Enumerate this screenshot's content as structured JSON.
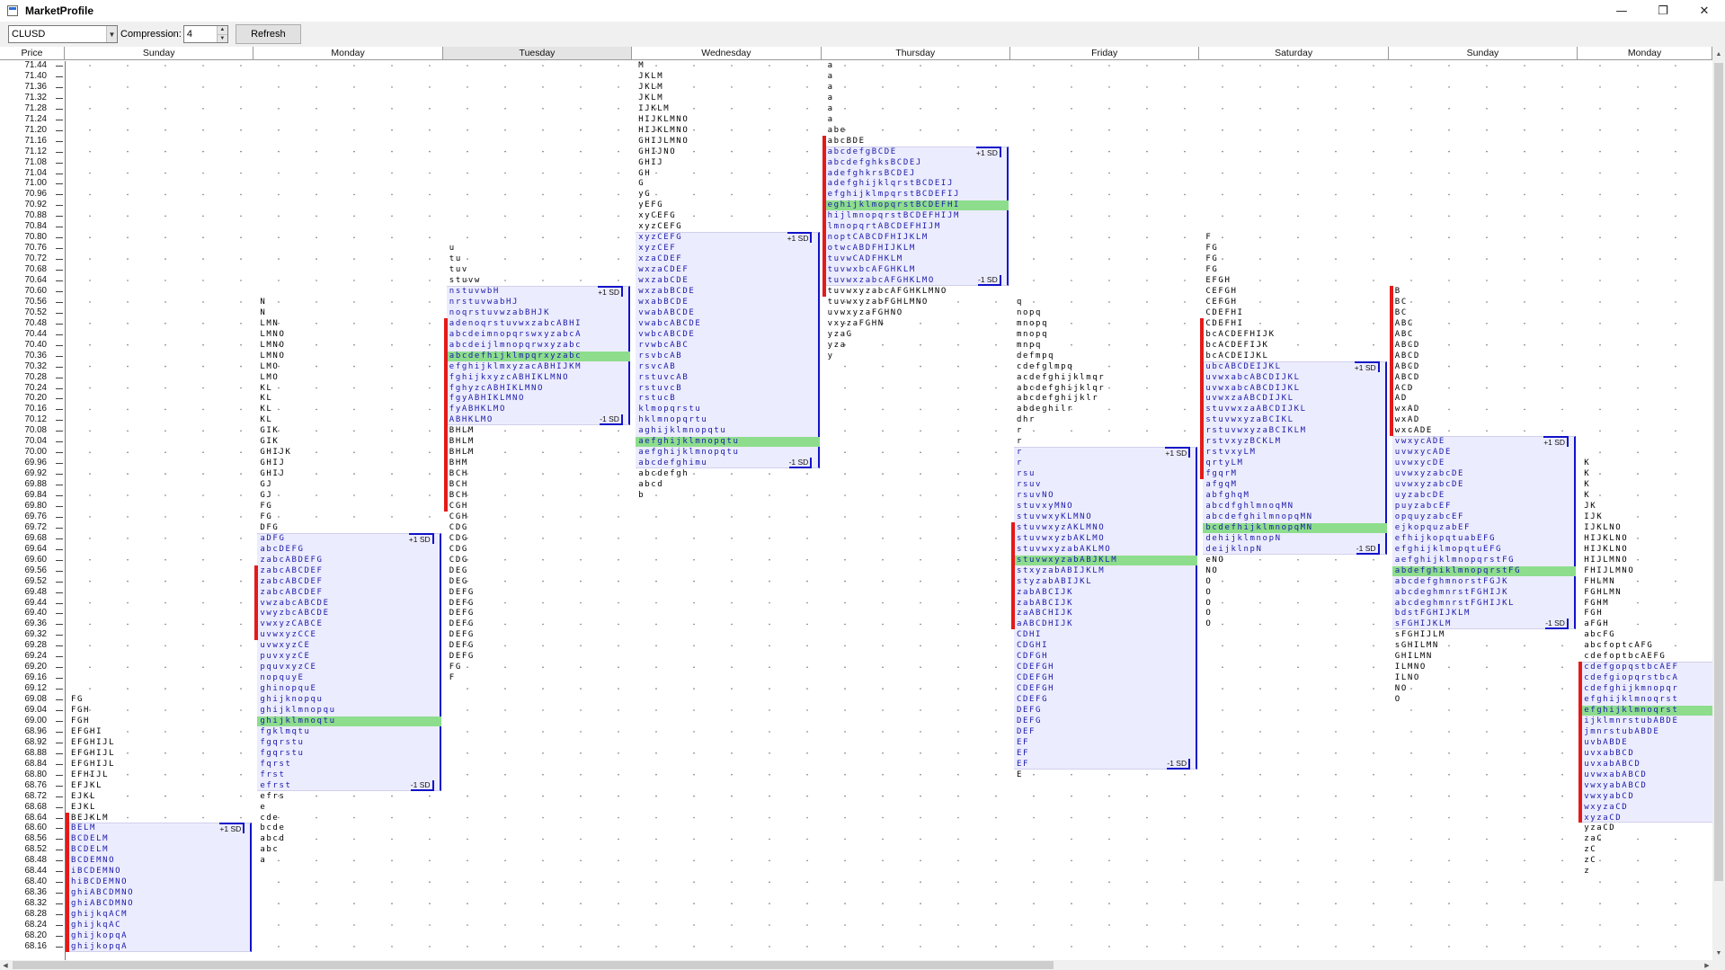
{
  "window": {
    "title": "MarketProfile",
    "controls": {
      "minimize": "—",
      "maximize": "❐",
      "close": "✕"
    }
  },
  "toolbar": {
    "symbol": "CLUSD",
    "compression_label": "Compression:",
    "compression_value": "4",
    "refresh_label": "Refresh"
  },
  "grid": {
    "price_header": "Price",
    "days": [
      {
        "label": "Sunday",
        "selected": false
      },
      {
        "label": "Monday",
        "selected": false
      },
      {
        "label": "Tuesday",
        "selected": true
      },
      {
        "label": "Wednesday",
        "selected": false
      },
      {
        "label": "Thursday",
        "selected": false
      },
      {
        "label": "Friday",
        "selected": false
      },
      {
        "label": "Saturday",
        "selected": false
      },
      {
        "label": "Sunday",
        "selected": false
      },
      {
        "label": "Monday",
        "selected": false
      }
    ],
    "prices": [
      "71.44",
      "71.40",
      "71.36",
      "71.32",
      "71.28",
      "71.24",
      "71.20",
      "71.16",
      "71.12",
      "71.08",
      "71.04",
      "71.00",
      "70.96",
      "70.92",
      "70.88",
      "70.84",
      "70.80",
      "70.76",
      "70.72",
      "70.68",
      "70.64",
      "70.60",
      "70.56",
      "70.52",
      "70.48",
      "70.44",
      "70.40",
      "70.36",
      "70.32",
      "70.28",
      "70.24",
      "70.20",
      "70.16",
      "70.12",
      "70.08",
      "70.04",
      "70.00",
      "69.96",
      "69.92",
      "69.88",
      "69.84",
      "69.80",
      "69.76",
      "69.72",
      "69.68",
      "69.64",
      "69.60",
      "69.56",
      "69.52",
      "69.48",
      "69.44",
      "69.40",
      "69.36",
      "69.32",
      "69.28",
      "69.24",
      "69.20",
      "69.16",
      "69.12",
      "69.08",
      "69.04",
      "69.00",
      "68.96",
      "68.92",
      "68.88",
      "68.84",
      "68.80",
      "68.76",
      "68.72",
      "68.68",
      "68.64",
      "68.60",
      "68.56",
      "68.52",
      "68.48",
      "68.44",
      "68.40",
      "68.36",
      "68.32",
      "68.28",
      "68.24",
      "68.20",
      "68.16"
    ],
    "sd_upper_label": "+1 SD",
    "sd_lower_label": "-1 SD",
    "colors": {
      "value_area": "#ececff",
      "sd_line": "#1212c8",
      "initial_balance": "#e41a1a",
      "poc": "#8ddd8d",
      "va_letters": "#1a1aa8"
    }
  },
  "profiles": [
    {
      "day": "Sunday",
      "start_price": "69.08",
      "value_area": {
        "high": "68.60",
        "low": "68.16"
      },
      "ib": {
        "high": "68.64",
        "low": "68.16"
      },
      "poc": null,
      "rows": [
        "FG",
        "FGH",
        "FGH",
        "EFGHI",
        "EFGHIJL",
        "EFGHIJL",
        "EFGHIJL",
        "EFHIJL",
        "EFJKL",
        "EJKL",
        "EJKL",
        "BEJKLM",
        "BELM",
        "BCDELM",
        "BCDELM",
        "BCDEMNO",
        "iBCDEMNO",
        "hiBCDEMNO",
        "ghiABCDMNO",
        "ghiABCDMNO",
        "ghijkqACM",
        "ghijkqAC",
        "ghijkopqA",
        "ghijkopqA",
        "ghijkopqA"
      ]
    },
    {
      "day": "Monday",
      "start_price": "70.56",
      "value_area": {
        "high": "69.68",
        "low": "68.76"
      },
      "ib": {
        "high": "69.56",
        "low": "69.32"
      },
      "poc": "69.00",
      "rows": [
        "N",
        "N",
        "LMN",
        "LMNO",
        "LMNO",
        "LMNO",
        "LMO",
        "LMO",
        "KL",
        "KL",
        "KL",
        "KL",
        "GIK",
        "GIK",
        "GHIJK",
        "GHIJ",
        "GHIJ",
        "GJ",
        "GJ",
        "FG",
        "FG",
        "DFG",
        "aDFG",
        "abcDEFG",
        "zabcABDEFG",
        "zabcABCDEF",
        "zabcABCDEF",
        "zabcABCDEF",
        "vwzabcABCDE",
        "vwyzbcABCDE",
        "vwxyzCABCE",
        "uvwxyzCCE",
        "uvwxyzCE",
        "puvxyzCE",
        "pquvxyzCE",
        "nopquyE",
        "ghinopquE",
        "ghijknopqu",
        "ghijklmnopqu",
        "ghijklmnoqtu",
        "fgklmqtu",
        "fgqrstu",
        "fgqrstu",
        "fqrst",
        "frst",
        "efrst",
        "efrs",
        "e",
        "cde",
        "bcde",
        "abcd",
        "abc",
        "a"
      ]
    },
    {
      "day": "Tuesday",
      "start_price": "70.76",
      "value_area": {
        "high": "70.60",
        "low": "70.12"
      },
      "ib": {
        "high": "70.48",
        "low": "69.80"
      },
      "poc": "70.36",
      "rows": [
        "u",
        "tu",
        "tuv",
        "stuvw",
        "nstuvwbH",
        "nrstuvwabHJ",
        "noqrstuvwzabBHJK",
        "adenoqrstuvwxzabcABHI",
        "abcdeimnopqrswxyzabcA",
        "abcdeijlmnopqrwxyzabc",
        "abcdefhijklmpqrxyzabc",
        "efghijklmxyzacABHIJKM",
        "fghijkxyzcABHIKLMNO",
        "fghyzcABHIKLMNO",
        "fgyABHIKLMNO",
        "fyABHKLMO",
        "ABHKLMO",
        "BHLM",
        "BHLM",
        "BHLM",
        "BHM",
        "BCH",
        "BCH",
        "BCH",
        "CGH",
        "CGH",
        "CDG",
        "CDG",
        "CDG",
        "CDG",
        "DEG",
        "DEG",
        "DEFG",
        "DEFG",
        "DEFG",
        "DEFG",
        "DEFG",
        "DEFG",
        "DEFG",
        "FG",
        "F"
      ]
    },
    {
      "day": "Wednesday",
      "start_price": "71.44",
      "value_area": {
        "high": "70.80",
        "low": "69.96"
      },
      "ib": null,
      "poc": "70.04",
      "rows": [
        "M",
        "JKLM",
        "JKLM",
        "JKLM",
        "IJKLM",
        "HIJKLMNO",
        "HIJKLMNO",
        "GHIJLMNO",
        "GHIJNO",
        "GHIJ",
        "GH",
        "G",
        "yG",
        "yEFG",
        "xyCEFG",
        "xyzCEFG",
        "xyzCEFG",
        "xyzCEF",
        "xzaCDEF",
        "wxzaCDEF",
        "wxzabCDE",
        "wxzabBCDE",
        "wxabBCDE",
        "vwabABCDE",
        "vwabcABCDE",
        "vwbcABCDE",
        "rvwbcABC",
        "rsvbcAB",
        "rsvcAB",
        "rstuvcAB",
        "rstuvcB",
        "rstucB",
        "klmopqrstu",
        "hklmnopqrtu",
        "aghijklmnopqtu",
        "aefghijklmnopqtu",
        "aefghijklmnopqtu",
        "abcdefghimu",
        "abcdefgh",
        "abcd",
        "b"
      ]
    },
    {
      "day": "Thursday",
      "start_price": "71.44",
      "value_area": {
        "high": "71.12",
        "low": "70.64"
      },
      "ib": {
        "high": "71.16",
        "low": "70.60"
      },
      "poc": "70.92",
      "rows": [
        "a",
        "a",
        "a",
        "a",
        "a",
        "a",
        "abe",
        "abcBDE",
        "abcdefgBCDE",
        "abcdefghksBCDEJ",
        "adefghkrsBCDEJ",
        "adefghijklqrstBCDEIJ",
        "efghijklmpqrstBCDEFIJ",
        "eghijklmopqrstBCDEFHI",
        "hijlmnopqrstBCDEFHIJM",
        "lmnopqrtABCDEFHIJM",
        "noptCABCDFHIJKLM",
        "otwcABDFHIJKLM",
        "tuvwCADFHKLM",
        "tuvwxbcAFGHKLM",
        "tuvwxzabcAFGHKLMO",
        "tuvwxyzabcAFGHKLMNO",
        "tuvwxyzabFGHLMNO",
        "uvwxyzaFGHNO",
        "vxyzaFGHN",
        "yzaG",
        "yza",
        "y"
      ]
    },
    {
      "day": "Friday",
      "start_price": "70.56",
      "value_area": {
        "high": "70.00",
        "low": "68.84"
      },
      "ib": {
        "high": "69.72",
        "low": "69.36"
      },
      "poc": "69.60",
      "rows": [
        "q",
        "nopq",
        "mnopq",
        "mnopq",
        "mnpq",
        "defmpq",
        "cdefglmpq",
        "acdefghijklmqr",
        "abcdefghijklqr",
        "abcdefghijklr",
        "abdeghilr",
        "dhr",
        "r",
        "r",
        "r",
        "r",
        "rsu",
        "rsuv",
        "rsuvNO",
        "stuvxyMNO",
        "stuvwxyKLMNO",
        "stuvwxyzAKLMNO",
        "stuvwxyzbAKLMO",
        "stuvwxyzabAKLMO",
        "stuvwxyzabABJKLM",
        "stxyzabABIJKLM",
        "styzabABIJKL",
        "zabABCIJK",
        "zabABCIJK",
        "zaABCHIJK",
        "aABCDHIJK",
        "CDHI",
        "CDGHI",
        "CDFGH",
        "CDEFGH",
        "CDEFGH",
        "CDEFGH",
        "CDEFG",
        "DEFG",
        "DEFG",
        "DEF",
        "EF",
        "EF",
        "EF",
        "E"
      ]
    },
    {
      "day": "Saturday",
      "start_price": "70.80",
      "value_area": {
        "high": "70.32",
        "low": "69.64"
      },
      "ib": {
        "high": "70.48",
        "low": "69.92"
      },
      "poc": "69.72",
      "rows": [
        "F",
        "FG",
        "FG",
        "FG",
        "EFGH",
        "CEFGH",
        "CEFGH",
        "CDEFHI",
        "CDEFHI",
        "bcACDEFHIJK",
        "bcACDEFIJK",
        "bcACDEIJKL",
        "ubcABCDEIJKL",
        "uvwxabcABCDIJKL",
        "uvwxabcABCDIJKL",
        "uvwxzaABCDIJKL",
        "stuvwxzaABCDIJKL",
        "stuvwxyzaBCIKL",
        "rstuvwxyzaBCIKLM",
        "rstvxyzBCKLM",
        "rstvxyLM",
        "qrtyLM",
        "fgqrM",
        "afgqM",
        "abfghqM",
        "abcdfghlmnoqMN",
        "abcdefghilmnopqMN",
        "bcdefhijklmnopqMN",
        "dehijklmnopN",
        "deijklnpN",
        "eNO",
        "NO",
        "O",
        "O",
        "O",
        "O",
        "O"
      ]
    },
    {
      "day": "Sunday",
      "start_price": "70.60",
      "value_area": {
        "high": "70.04",
        "low": "69.36"
      },
      "ib": {
        "high": "70.60",
        "low": "70.08"
      },
      "poc": "69.56",
      "rows": [
        "B",
        "BC",
        "BC",
        "ABC",
        "ABC",
        "ABCD",
        "ABCD",
        "ABCD",
        "ABCD",
        "ACD",
        "AD",
        "wxAD",
        "wxAD",
        "wxcADE",
        "vwxycADE",
        "uvwxycADE",
        "uvwxycDE",
        "uvwxyzabcDE",
        "uvwxyzabcDE",
        "uyzabcDE",
        "puyzabcEF",
        "opquyzabcEF",
        "ejkopquzabEF",
        "efhijkopqtuabEFG",
        "efghijklmopqtuEFG",
        "aefghijklmnopqrstFG",
        "abdefghiklmnopqrstFG",
        "abcdefghmnorstFGJK",
        "abcdeghmnrstFGHIJK",
        "abcdeghmnrstFGHIJKL",
        "bdstFGHIJKLM",
        "sFGHIJKLM",
        "sFGHIJLM",
        "sGHILMN",
        "GHILMN",
        "ILMNO",
        "ILNO",
        "NO",
        "O"
      ]
    },
    {
      "day": "Monday",
      "start_price": "69.96",
      "value_area": {
        "high": "69.20",
        "low": "68.64"
      },
      "ib": {
        "high": "69.20",
        "low": "68.64"
      },
      "poc": "69.04",
      "rows": [
        "K",
        "K",
        "K",
        "K",
        "JK",
        "IJK",
        "IJKLNO",
        "HIJKLNO",
        "HIJKLNO",
        "HIJLMNO",
        "FHIJLMNO",
        "FHLMN",
        "FGHLMN",
        "FGHM",
        "FGH",
        "aFGH",
        "abcFG",
        "abcfoptcAFG",
        "cdefoptbcAEFG",
        "cdefgopqstbcAEF",
        "cdefgiopqrstbcA",
        "cdefghijkmnopqr",
        "efghijklmnoqrst",
        "efghijklmnoqrst",
        "ijklmnrstubABDE",
        "jmnrstubABDE",
        "uvbABDE",
        "uvxabBCD",
        "uvxabABCD",
        "uvwxabABCD",
        "vwxyabABCD",
        "vwxyabCD",
        "wxyzaCD",
        "xyzaCD",
        "yzaCD",
        "zaC",
        "zC",
        "zC",
        "z"
      ]
    }
  ]
}
